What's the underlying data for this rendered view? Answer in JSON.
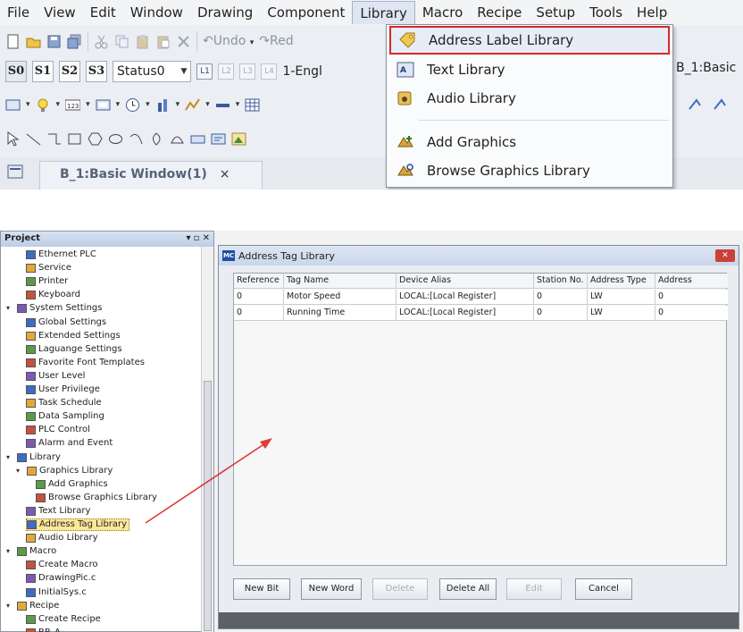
{
  "menubar": {
    "items": [
      "File",
      "View",
      "Edit",
      "Window",
      "Drawing",
      "Component",
      "Library",
      "Macro",
      "Recipe",
      "Setup",
      "Tools",
      "Help"
    ]
  },
  "toolbar": {
    "undo_label": "Undo",
    "redo_label": "Red",
    "state_buttons": [
      "S0",
      "S1",
      "S2",
      "S3"
    ],
    "status_combo": "Status0",
    "layer_buttons": [
      "L1",
      "L2",
      "L3",
      "L4"
    ],
    "language_combo": "1-Engl",
    "window_combo": "B_1:Basic",
    "numeric_icon_label": "123"
  },
  "doc_tab": {
    "label": "B_1:Basic Window(1)",
    "close": "×"
  },
  "library_menu": {
    "items": [
      {
        "label": "Address Label Library",
        "icon": "tag-icon"
      },
      {
        "label": "Text Library",
        "icon": "text-icon"
      },
      {
        "label": "Audio Library",
        "icon": "audio-icon"
      },
      {
        "label": "Add Graphics",
        "icon": "add-graphics-icon"
      },
      {
        "label": "Browse Graphics Library",
        "icon": "browse-graphics-icon"
      }
    ],
    "highlight_color": "#d92828"
  },
  "project_panel": {
    "title": "Project",
    "controls": "▾ ▫ ✕",
    "tree": [
      {
        "label": "Ethernet PLC",
        "indent": 3
      },
      {
        "label": "Service",
        "indent": 3
      },
      {
        "label": "Printer",
        "indent": 3
      },
      {
        "label": "Keyboard",
        "indent": 3
      },
      {
        "label": "System Settings",
        "indent": 1,
        "expander": "▾"
      },
      {
        "label": "Global Settings",
        "indent": 3
      },
      {
        "label": "Extended Settings",
        "indent": 3
      },
      {
        "label": "Laguange Settings",
        "indent": 3
      },
      {
        "label": "Favorite Font Templates",
        "indent": 3
      },
      {
        "label": "User Level",
        "indent": 3
      },
      {
        "label": "User Privilege",
        "indent": 3
      },
      {
        "label": "Task Schedule",
        "indent": 3
      },
      {
        "label": "Data Sampling",
        "indent": 3
      },
      {
        "label": "PLC Control",
        "indent": 3
      },
      {
        "label": "Alarm and Event",
        "indent": 3
      },
      {
        "label": "Library",
        "indent": 1,
        "expander": "▾"
      },
      {
        "label": "Graphics Library",
        "indent": 2,
        "expander": "▾"
      },
      {
        "label": "Add Graphics",
        "indent": 4
      },
      {
        "label": "Browse Graphics Library",
        "indent": 4
      },
      {
        "label": "Text Library",
        "indent": 3
      },
      {
        "label": "Address Tag Library",
        "indent": 3,
        "selected": true
      },
      {
        "label": "Audio Library",
        "indent": 3
      },
      {
        "label": "Macro",
        "indent": 1,
        "expander": "▾"
      },
      {
        "label": "Create Macro",
        "indent": 3
      },
      {
        "label": "DrawingPic.c",
        "indent": 3
      },
      {
        "label": "InitialSys.c",
        "indent": 3
      },
      {
        "label": "Recipe",
        "indent": 1,
        "expander": "▾"
      },
      {
        "label": "Create Recipe",
        "indent": 3
      },
      {
        "label": "RP_A",
        "indent": 3
      }
    ]
  },
  "dialog": {
    "title": "Address Tag Library",
    "logo": "MC",
    "close": "✕",
    "columns": [
      "Reference",
      "Tag Name",
      "Device Alias",
      "Station No.",
      "Address Type",
      "Address"
    ],
    "rows": [
      [
        "0",
        "Motor Speed",
        "LOCAL:[Local Register]",
        "0",
        "LW",
        "0"
      ],
      [
        "0",
        "Running Time",
        "LOCAL:[Local Register]",
        "0",
        "LW",
        "0"
      ]
    ],
    "buttons": [
      {
        "label": "New Bit",
        "enabled": true
      },
      {
        "label": "New Word",
        "enabled": true
      },
      {
        "label": "Delete",
        "enabled": false
      },
      {
        "label": "Delete All",
        "enabled": true
      },
      {
        "label": "Edit",
        "enabled": false
      },
      {
        "label": "Cancel",
        "enabled": true
      }
    ]
  },
  "annotation": {
    "arrow_color": "#e03a3a"
  }
}
